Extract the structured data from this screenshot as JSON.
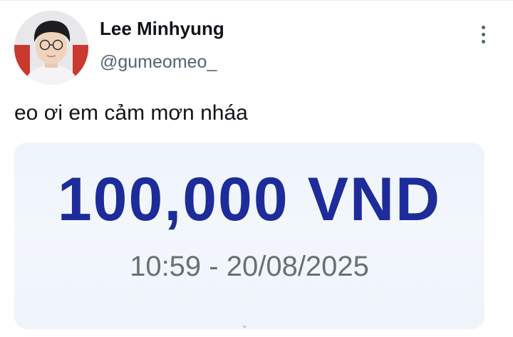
{
  "post": {
    "author": {
      "display_name": "Lee Minhyung",
      "handle": "@gumeomeo_"
    },
    "more_icon": "more-vertical-icon",
    "text": "eo ơi em cảm mơn nháa",
    "media": {
      "amount": "100,000 VND",
      "timestamp": "10:59 - 20/08/2025"
    }
  },
  "colors": {
    "text_primary": "#0f1419",
    "text_secondary": "#536471",
    "amount_blue": "#1d2c9a",
    "timestamp_gray": "#6a6f76",
    "card_background": "#eef4fa"
  }
}
